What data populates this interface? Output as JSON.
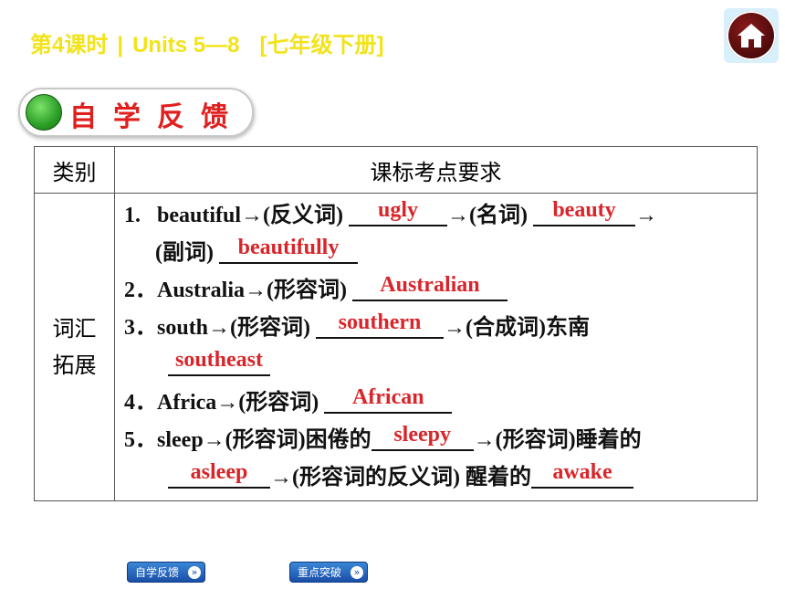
{
  "header": {
    "lesson": "第4课时",
    "divider": "|",
    "units": "Units 5—8",
    "grade": "[七年级下册]"
  },
  "section": {
    "title": "自学反馈"
  },
  "table": {
    "headers": {
      "category": "类别",
      "requirements": "课标考点要求"
    },
    "category": {
      "line1": "词汇",
      "line2": "拓展"
    },
    "items": {
      "i1": {
        "num": "1.",
        "word": "beautiful→(反义词)",
        "ans1": "ugly",
        "mid": "→(名词)",
        "ans2": "beauty",
        "tail": "→",
        "pre2": "(副词)",
        "ans3": "beautifully"
      },
      "i2": {
        "num": "2．",
        "word": "Australia→(形容词)",
        "ans1": "Australian"
      },
      "i3": {
        "num": "3．",
        "word": "south→(形容词)",
        "ans1": "southern",
        "mid": "→(合成词)东南",
        "ans2": "southeast"
      },
      "i4": {
        "num": "4．",
        "word": "Africa→(形容词)",
        "ans1": "African"
      },
      "i5": {
        "num": "5．",
        "word": "sleep→(形容词)困倦的",
        "ans1": "sleepy",
        "mid": "→(形容词)睡着的",
        "ans2": "asleep",
        "mid2": "→(形容词的反义词) 醒着的",
        "ans3": "awake"
      }
    }
  },
  "nav": {
    "self_study": "自学反馈",
    "key_points": "重点突破"
  }
}
